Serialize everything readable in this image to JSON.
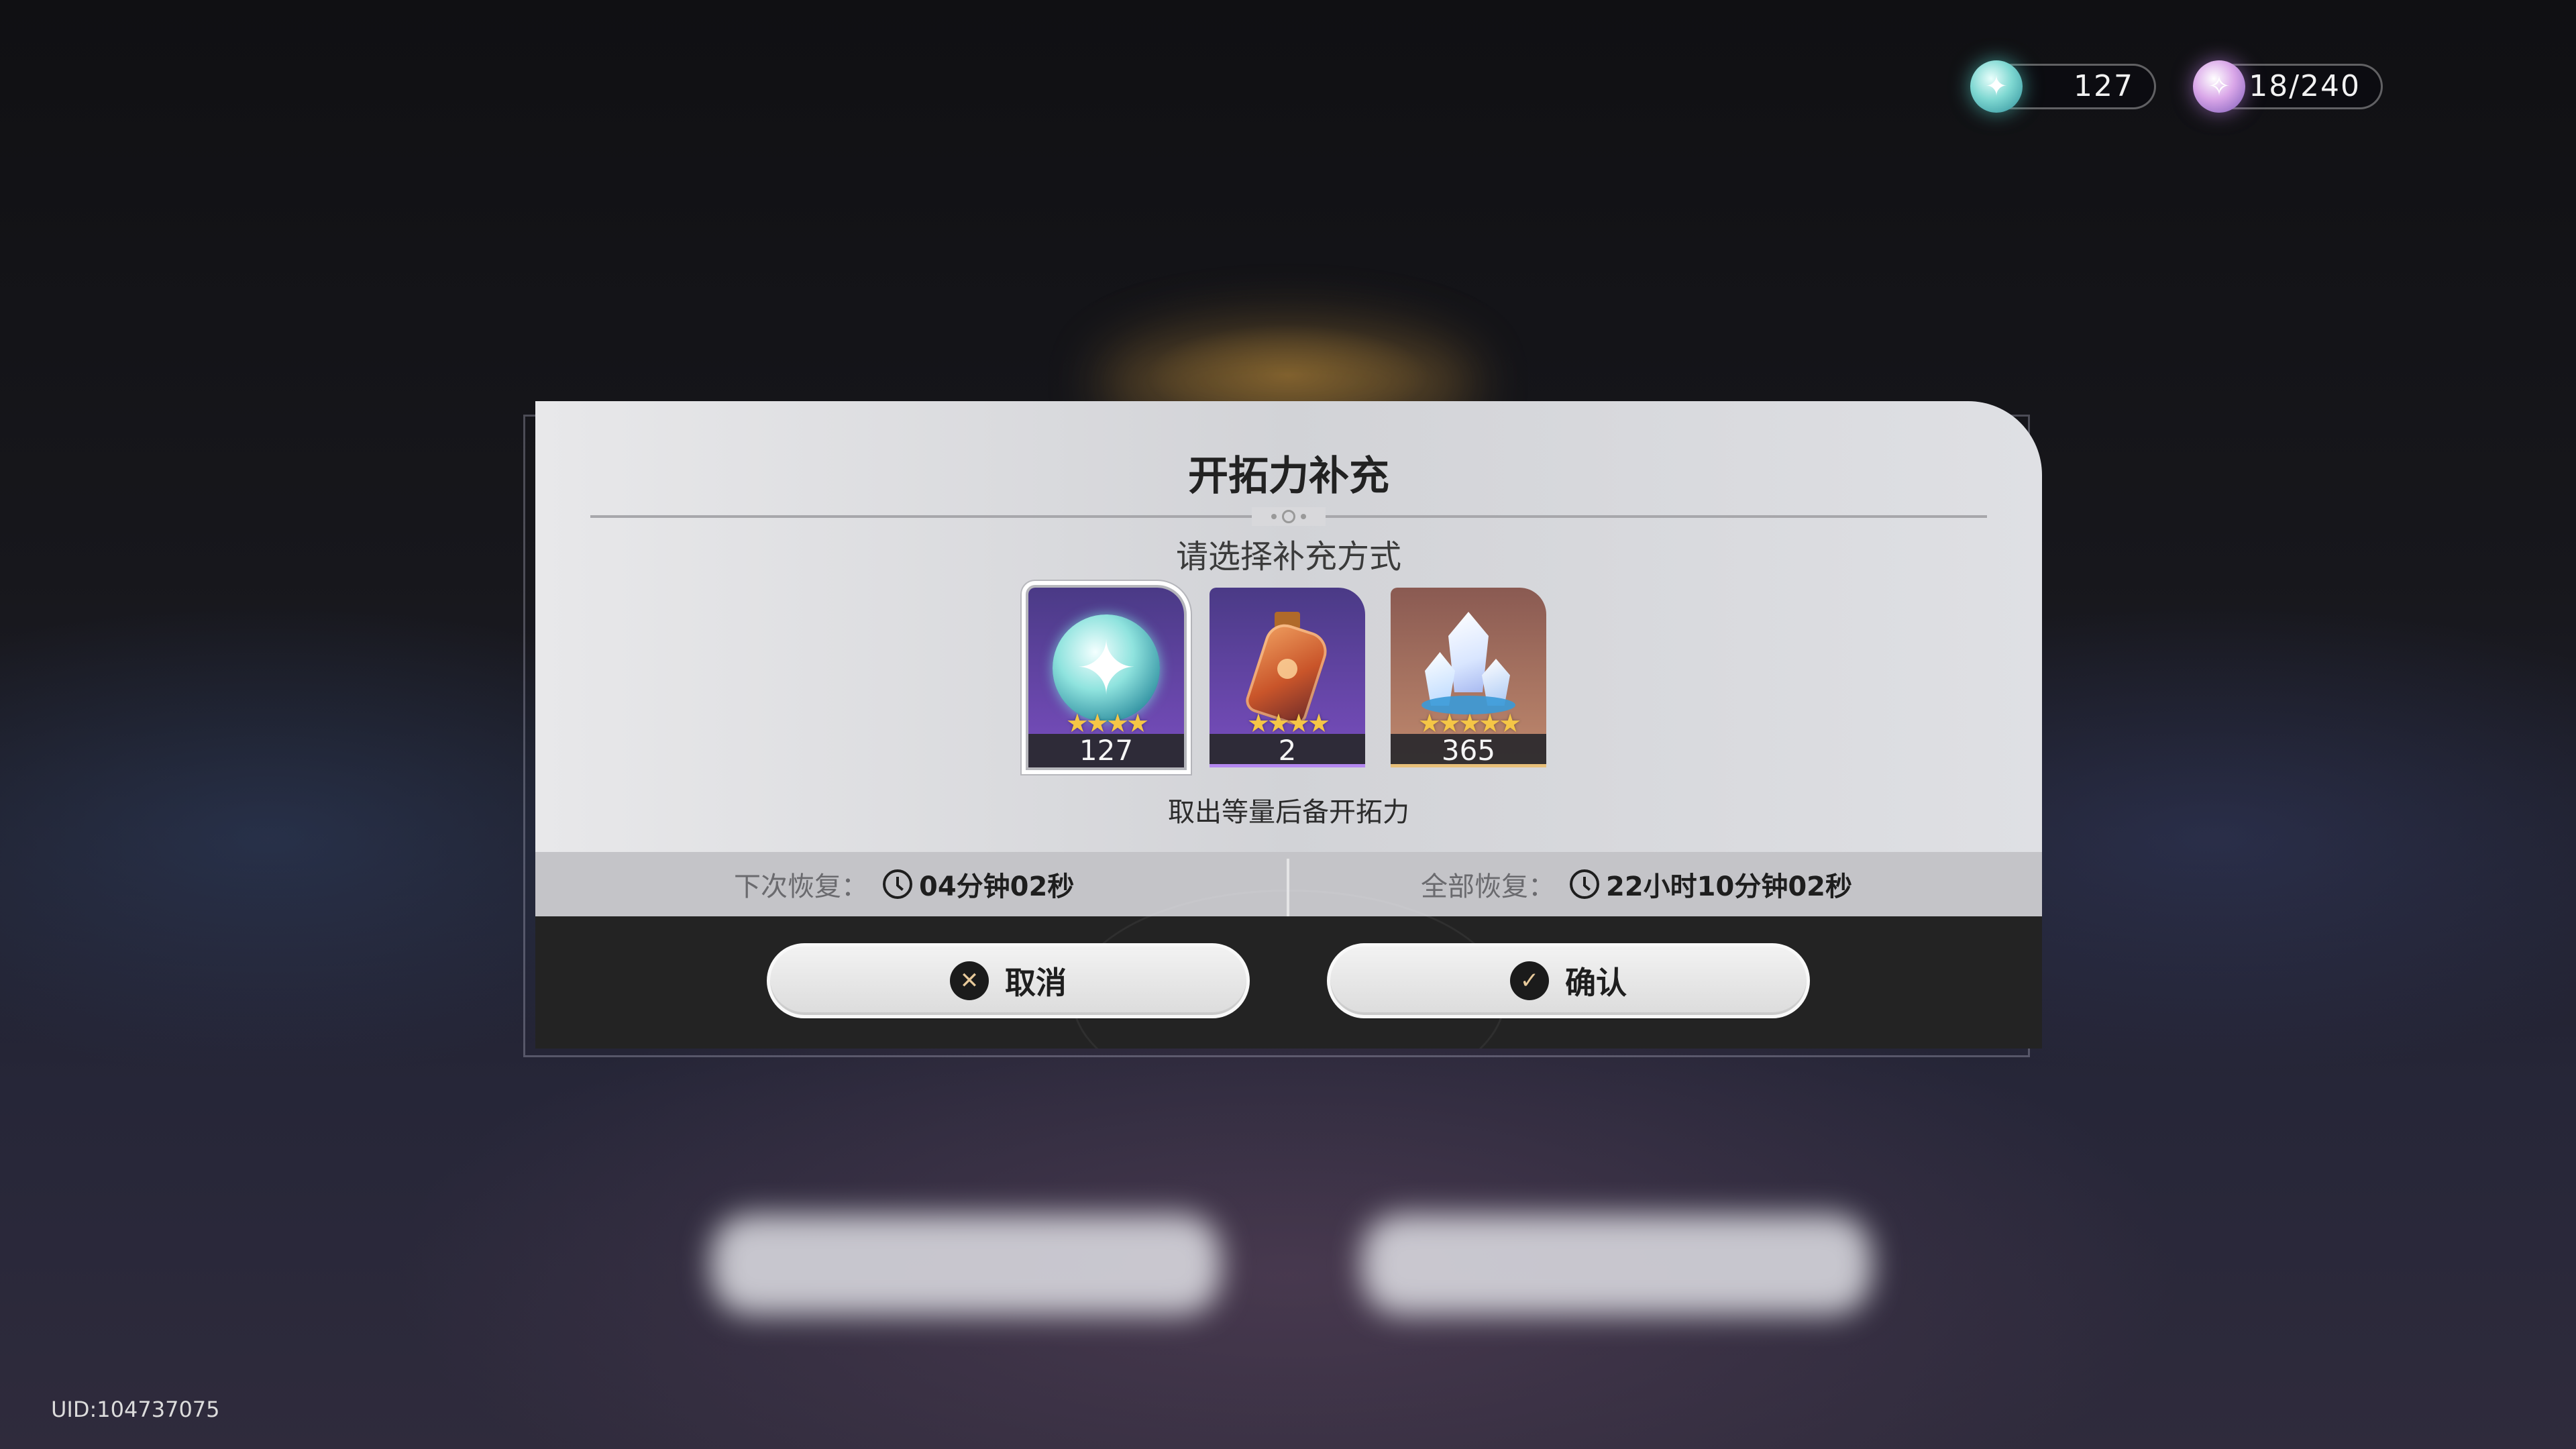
{
  "hud": {
    "stellar_jade": {
      "icon": "stellar-jade-icon",
      "value": "127"
    },
    "trailblaze_power": {
      "icon": "trailblaze-power-icon",
      "value": "18/240"
    }
  },
  "dialog": {
    "title": "开拓力补充",
    "subtitle": "请选择补充方式",
    "items": [
      {
        "name": "stellar-jade",
        "icon": "stellar-jade-icon",
        "stars": "★★★★",
        "count": "127",
        "selected": true
      },
      {
        "name": "fuel",
        "icon": "fuel-bottle-icon",
        "stars": "★★★★",
        "count": "2",
        "selected": false
      },
      {
        "name": "oneiric-shard",
        "icon": "crystal-icon",
        "stars": "★★★★★",
        "count": "365",
        "selected": false
      }
    ],
    "description": "取出等量后备开拓力",
    "next_recovery": {
      "label": "下次恢复：",
      "value": "04分钟02秒"
    },
    "full_recovery": {
      "label": "全部恢复：",
      "value": "22小时10分钟02秒"
    },
    "cancel": {
      "label": "取消",
      "icon_glyph": "✕"
    },
    "confirm": {
      "label": "确认",
      "icon_glyph": "✓"
    }
  },
  "uid": "UID:104737075",
  "colors": {
    "star": "#f5c646",
    "button_icon_bg": "#1b1b1b",
    "footer": "#232323"
  }
}
